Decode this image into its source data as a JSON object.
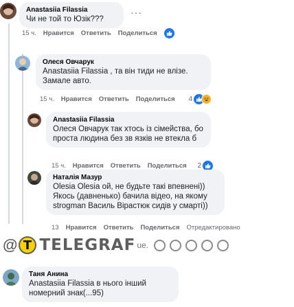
{
  "labels": {
    "like": "Нравится",
    "reply": "Ответить",
    "share": "Поделиться",
    "edited": "Отредактировано"
  },
  "colors": {
    "like_blue": "#1877f2",
    "bubble_bg": "#f0f2f5",
    "meta_gray": "#65676b",
    "telegraf_yellow": "#f5d200"
  },
  "comments": [
    {
      "author": "Anastasiia Filassia",
      "text": "Чи не той то Юзік???",
      "time": "15 ч.",
      "reaction_count": ""
    },
    {
      "author": "Олеся Овчарук",
      "text": "Anastasiia Filassia , та він тиди не влізе. Замале авто.",
      "time": "15 ч.",
      "reaction_count": "4"
    },
    {
      "author": "Anastasiia Filassia",
      "text": "Олеся Овчарук так хтось із сімейства, бо проста людина без зв язків не втекла б",
      "time": "15 ч.",
      "reaction_count": "2"
    },
    {
      "author": "Наталія Мазур",
      "text": "Olesia Olesia ой, не будьте такі впевнені)) Якось (давненько) бачила відео, на якому strogman Василь Вірастюк сидів у смарті))",
      "time": "13",
      "reaction_count": ""
    },
    {
      "author": "Таня Анина",
      "text": "Anastasiia Filassia в нього інший номерний знак(...95)",
      "time": "",
      "reaction_count": ""
    }
  ],
  "watermark": {
    "brand": "TELEGRAF",
    "logo_letter": "T",
    "suffix": "ue."
  },
  "icons": [
    "like-icon",
    "haha-icon",
    "more-dots-icon",
    "telegraf-logo-icon"
  ]
}
